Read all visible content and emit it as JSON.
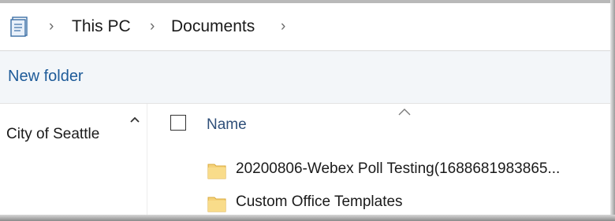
{
  "address_bar": {
    "icon": "documents-location-icon",
    "breadcrumbs": [
      "This PC",
      "Documents"
    ]
  },
  "command_bar": {
    "new_folder_label": "New folder"
  },
  "nav_pane": {
    "items": [
      "City of Seattle"
    ]
  },
  "file_list": {
    "column_name": "Name",
    "rows": [
      {
        "label": "20200806-Webex Poll Testing(1688681983865...",
        "icon": "folder-icon"
      },
      {
        "label": "Custom Office Templates",
        "icon": "folder-icon"
      }
    ]
  },
  "colors": {
    "accent_link": "#1e5b99",
    "header_text": "#2f4f79",
    "folder_yellow": "#f5d27a",
    "command_bar_bg": "#f3f6f9"
  }
}
